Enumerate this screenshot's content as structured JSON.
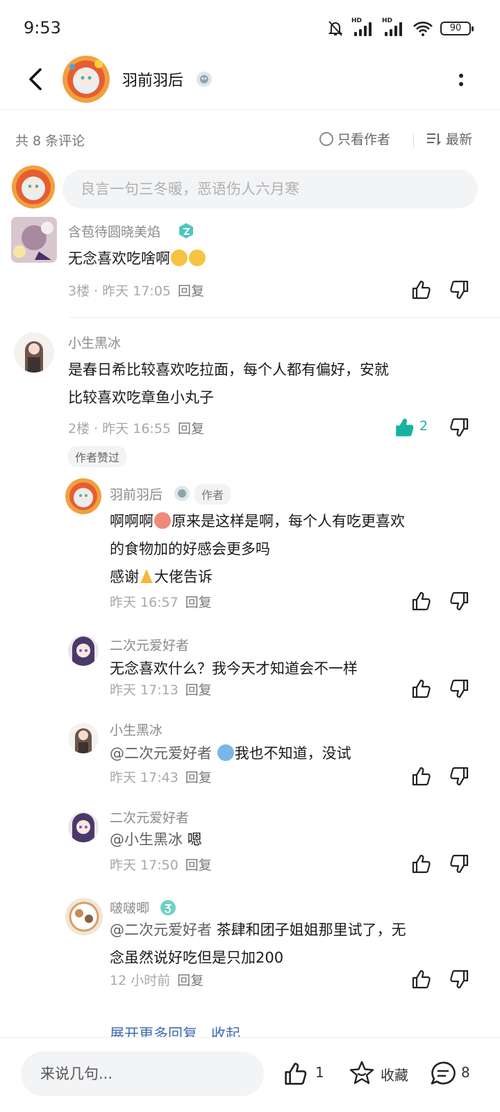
{
  "status": {
    "time": "9:53",
    "battery": "90",
    "hd1": "HD",
    "hd2": "HD"
  },
  "header": {
    "title": "羽前羽后"
  },
  "filter": {
    "count": "共 8 条评论",
    "author_only": "只看作者",
    "sort": "最新"
  },
  "compose": {
    "placeholder": "良言一句三冬暖，恶语伤人六月寒"
  },
  "comments": [
    {
      "user": "含苞待圆晓美焰",
      "text": "无念喜欢吃啥啊",
      "floor": "3楼",
      "time": "昨天 17:05",
      "reply": "回复"
    },
    {
      "user": "小生黑冰",
      "text_line1": "是春日希比较喜欢吃拉面，每个人都有偏好，安就",
      "text_line2": "比较喜欢吃章鱼小丸子",
      "floor": "2楼",
      "time": "昨天 16:55",
      "reply": "回复",
      "likes": "2",
      "tag": "作者赞过"
    }
  ],
  "replies": [
    {
      "user": "羽前羽后",
      "author_tag": "作者",
      "line1_a": "啊啊啊",
      "line1_b": "原来是这样是啊，每个人有吃更喜欢",
      "line2": "的食物加的好感会更多吗",
      "line3_a": "感谢",
      "line3_b": "大佬告诉",
      "time": "昨天 16:57",
      "reply": "回复"
    },
    {
      "user": "二次元爱好者",
      "text": "无念喜欢什么？我今天才知道会不一样",
      "time": "昨天 17:13",
      "reply": "回复"
    },
    {
      "user": "小生黑冰",
      "mention": "@二次元爱好者",
      "text": "我也不知道，没试",
      "time": "昨天 17:43",
      "reply": "回复"
    },
    {
      "user": "二次元爱好者",
      "mention": "@小生黑冰",
      "text": "嗯",
      "time": "昨天 17:50",
      "reply": "回复"
    },
    {
      "user": "啵啵唧",
      "mention": "@二次元爱好者",
      "text_line1": "茶肆和团子姐姐那里试了，无",
      "text_line2": "念虽然说好吃但是只加200",
      "time": "12 小时前",
      "reply": "回复"
    }
  ],
  "expand": {
    "more": "展开更多回复",
    "collapse": "收起"
  },
  "bottom": {
    "input": "来说几句...",
    "like_count": "1",
    "fav_label": "收藏",
    "comment_count": "8"
  },
  "colors": {
    "accent": "#16b3a3",
    "link": "#3f6ab0",
    "muted": "#a8a8a8"
  }
}
